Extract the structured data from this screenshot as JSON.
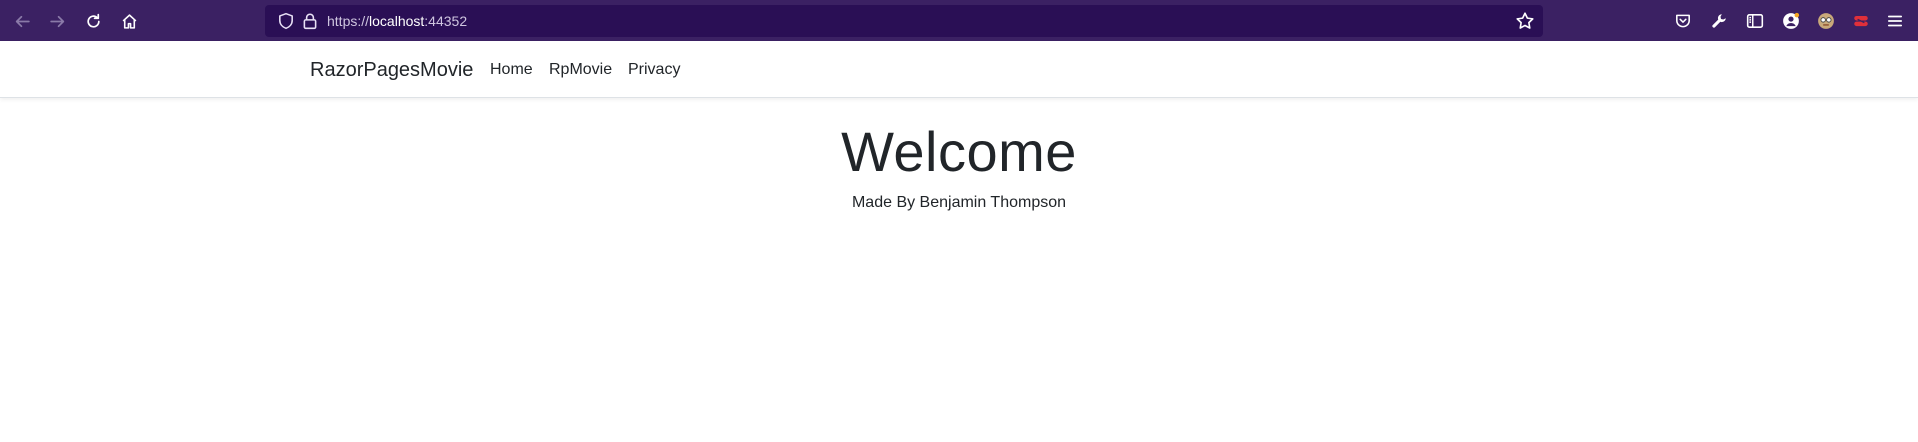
{
  "browser": {
    "url_scheme": "https://",
    "url_host": "localhost",
    "url_port": ":44352",
    "icons": [
      "back-arrow-icon",
      "forward-arrow-icon",
      "reload-icon",
      "home-icon",
      "shield-icon",
      "lock-icon",
      "star-icon",
      "pocket-icon",
      "wrench-icon",
      "sidebar-icon",
      "account-icon",
      "extension-icon",
      "extension-icon",
      "menu-icon"
    ],
    "colors": {
      "chrome_bg": "#3b2163",
      "urlbar_bg": "#2a0f55"
    }
  },
  "navbar": {
    "brand": "RazorPagesMovie",
    "links": [
      "Home",
      "RpMovie",
      "Privacy"
    ]
  },
  "main": {
    "heading": "Welcome",
    "credit": "Made By Benjamin Thompson"
  }
}
